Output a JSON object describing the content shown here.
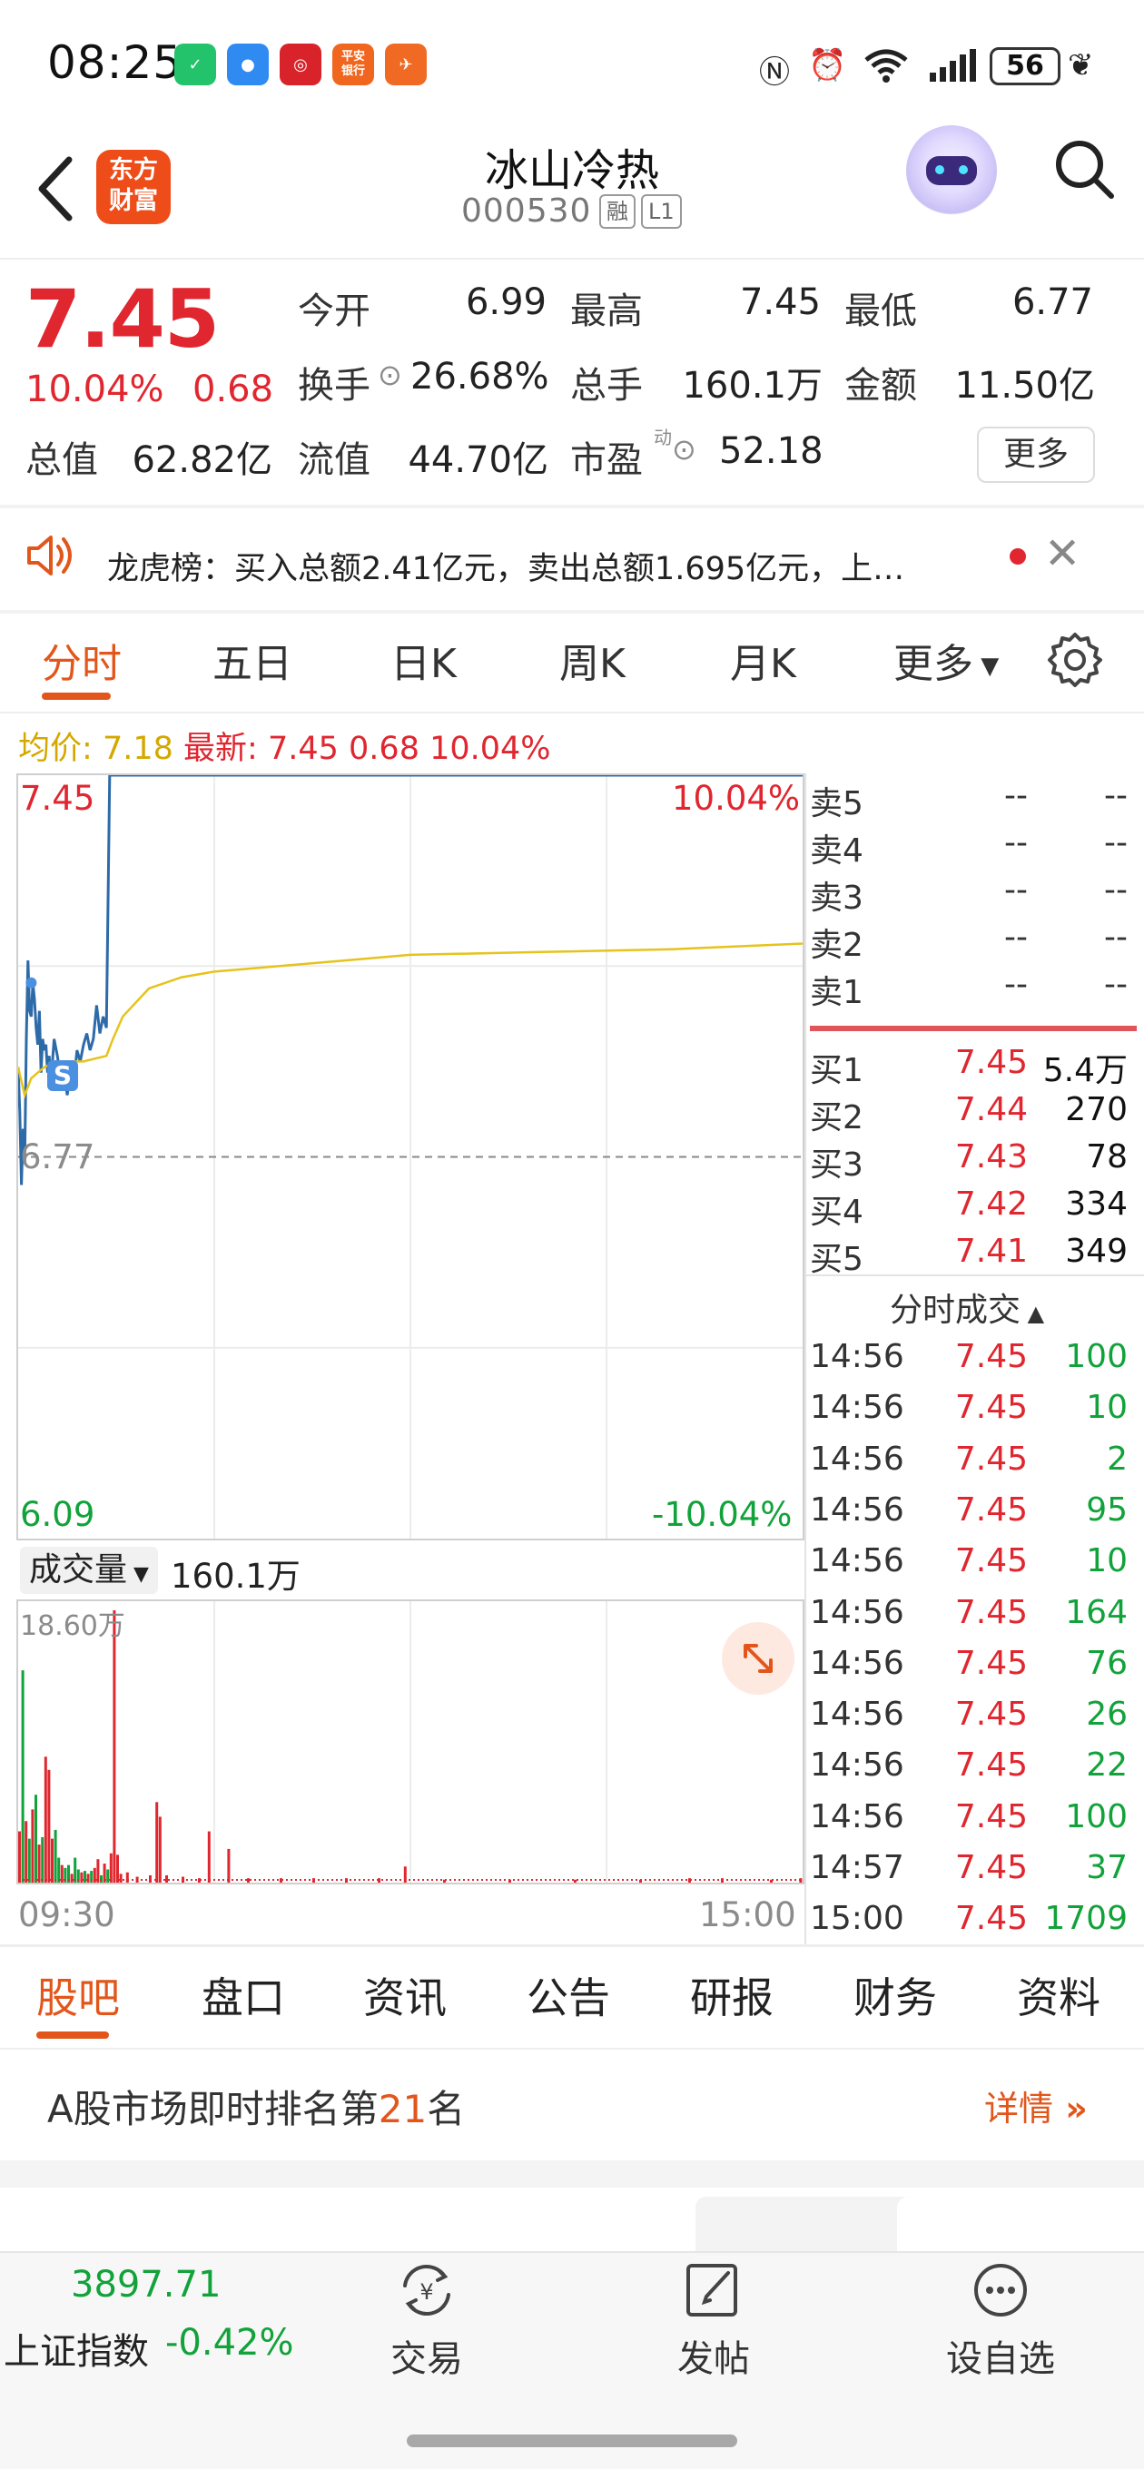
{
  "status_bar": {
    "time": "08:25",
    "battery": "56",
    "app_icons": [
      "wechat-pay-icon",
      "message-icon",
      "boc-icon",
      "pingan-icon",
      "forum-icon"
    ],
    "app_icon_text": [
      "",
      "",
      "",
      "平安\n银行",
      ""
    ],
    "system_icons": [
      "nfc-icon",
      "alarm-icon",
      "wifi-icon",
      "signal-icon",
      "battery-icon",
      "leaf-icon"
    ]
  },
  "header": {
    "logo_text": "东方\n财富",
    "stock_name": "冰山冷热",
    "stock_code": "000530",
    "tag_margin": "融",
    "tag_level": "L1"
  },
  "quote": {
    "price": "7.45",
    "pct": "10.04%",
    "change": "0.68",
    "rows": [
      [
        {
          "label": "今开",
          "value": "6.99",
          "color": "red"
        },
        {
          "label": "最高",
          "value": "7.45",
          "color": "red"
        },
        {
          "label": "最低",
          "value": "6.77",
          "color": "dark"
        }
      ],
      [
        {
          "label": "换手",
          "value": "26.68%",
          "color": "dark"
        },
        {
          "label": "总手",
          "value": "160.1万",
          "color": "dark"
        },
        {
          "label": "金额",
          "value": "11.50亿",
          "color": "dark"
        }
      ],
      [
        {
          "label": "总值",
          "value": "62.82亿",
          "color": "dark"
        },
        {
          "label": "流值",
          "value": "44.70亿",
          "color": "dark"
        },
        {
          "label": "市盈",
          "value": "52.18",
          "color": "dark"
        }
      ]
    ],
    "pe_superscript": "动",
    "more_button": "更多"
  },
  "notice": {
    "text": "龙虎榜：买入总额2.41亿元，卖出总额1.695亿元，上…"
  },
  "chart_tabs": {
    "items": [
      "分时",
      "五日",
      "日K",
      "周K",
      "月K",
      "更多"
    ],
    "active": 0
  },
  "chart_info": {
    "avg_label": "均价:",
    "avg_value": "7.18",
    "latest_label": "最新:",
    "latest_price": "7.45",
    "latest_change": "0.68",
    "latest_pct": "10.04%"
  },
  "chart_data": {
    "type": "line",
    "x_start": "09:30",
    "x_end": "15:00",
    "y_top_label": "7.45",
    "y_bottom_label": "6.09",
    "y_right_top": "10.04%",
    "y_right_bottom": "-10.04%",
    "ref_line_label": "6.77",
    "ylim": [
      6.09,
      7.45
    ],
    "ref_value": 6.77,
    "marker": "S",
    "series": [
      {
        "name": "",
        "color": "#2d6aa8",
        "values_t": [
          0,
          0.5,
          1,
          1.5,
          2,
          2.5,
          3,
          3.5,
          4,
          4.5,
          5,
          5.5,
          6,
          6.5,
          7,
          7.5,
          8,
          8.5,
          9,
          9.5,
          10,
          11,
          12,
          13,
          14,
          15,
          16,
          17,
          18,
          19,
          20,
          21,
          22,
          23,
          24,
          25,
          26,
          27,
          28,
          28.5,
          29,
          60,
          120,
          240
        ],
        "values": [
          6.93,
          6.85,
          6.72,
          6.82,
          6.76,
          6.98,
          7.12,
          7.03,
          7.02,
          7.08,
          7.05,
          7.0,
          6.97,
          7.03,
          6.92,
          6.98,
          6.96,
          6.97,
          6.92,
          6.95,
          6.9,
          6.98,
          6.95,
          6.91,
          6.93,
          6.88,
          6.92,
          6.9,
          6.96,
          6.94,
          6.97,
          6.99,
          6.96,
          6.98,
          7.04,
          6.99,
          7.02,
          7.0,
          7.45,
          7.45,
          7.45,
          7.45,
          7.45,
          7.45
        ]
      },
      {
        "name": "",
        "color": "#e6c31c",
        "values_t": [
          0,
          2,
          4,
          8,
          12,
          20,
          27,
          29,
          32,
          40,
          50,
          60,
          80,
          100,
          120,
          160,
          200,
          240
        ],
        "values": [
          6.93,
          6.88,
          6.91,
          6.93,
          6.94,
          6.94,
          6.95,
          6.98,
          7.02,
          7.07,
          7.09,
          7.1,
          7.11,
          7.12,
          7.13,
          7.135,
          7.14,
          7.15
        ]
      }
    ]
  },
  "volume": {
    "selector": "成交量",
    "total": "160.1万",
    "max_label": "18.60万",
    "max_value": 18.6,
    "bars": [
      {
        "t": 0,
        "v": 3.5,
        "c": "r"
      },
      {
        "t": 1,
        "v": 14.5,
        "c": "g"
      },
      {
        "t": 2,
        "v": 4.2,
        "c": "r"
      },
      {
        "t": 3,
        "v": 3.0,
        "c": "g"
      },
      {
        "t": 4,
        "v": 5.0,
        "c": "r"
      },
      {
        "t": 5,
        "v": 6.0,
        "c": "g"
      },
      {
        "t": 6,
        "v": 2.6,
        "c": "r"
      },
      {
        "t": 7,
        "v": 3.1,
        "c": "g"
      },
      {
        "t": 8,
        "v": 8.6,
        "c": "r"
      },
      {
        "t": 9,
        "v": 7.7,
        "c": "r"
      },
      {
        "t": 10,
        "v": 3.0,
        "c": "r"
      },
      {
        "t": 11,
        "v": 3.6,
        "c": "g"
      },
      {
        "t": 12,
        "v": 1.7,
        "c": "g"
      },
      {
        "t": 13,
        "v": 1.2,
        "c": "r"
      },
      {
        "t": 14,
        "v": 1.0,
        "c": "g"
      },
      {
        "t": 15,
        "v": 1.2,
        "c": "g"
      },
      {
        "t": 16,
        "v": 0.6,
        "c": "r"
      },
      {
        "t": 17,
        "v": 1.7,
        "c": "g"
      },
      {
        "t": 18,
        "v": 0.9,
        "c": "g"
      },
      {
        "t": 19,
        "v": 0.7,
        "c": "r"
      },
      {
        "t": 20,
        "v": 0.8,
        "c": "g"
      },
      {
        "t": 21,
        "v": 0.6,
        "c": "r"
      },
      {
        "t": 22,
        "v": 0.8,
        "c": "g"
      },
      {
        "t": 23,
        "v": 1.0,
        "c": "r"
      },
      {
        "t": 24,
        "v": 1.6,
        "c": "r"
      },
      {
        "t": 25,
        "v": 0.5,
        "c": "g"
      },
      {
        "t": 26,
        "v": 1.3,
        "c": "r"
      },
      {
        "t": 27,
        "v": 0.9,
        "c": "g"
      },
      {
        "t": 28,
        "v": 2.0,
        "c": "r"
      },
      {
        "t": 29,
        "v": 18.6,
        "c": "r"
      },
      {
        "t": 30,
        "v": 1.9,
        "c": "r"
      },
      {
        "t": 31,
        "v": 0.6,
        "c": "r"
      },
      {
        "t": 33,
        "v": 0.7,
        "c": "r"
      },
      {
        "t": 36,
        "v": 0.4,
        "c": "r"
      },
      {
        "t": 40,
        "v": 0.5,
        "c": "r"
      },
      {
        "t": 42,
        "v": 5.5,
        "c": "r"
      },
      {
        "t": 43,
        "v": 4.5,
        "c": "r"
      },
      {
        "t": 45,
        "v": 0.5,
        "c": "r"
      },
      {
        "t": 50,
        "v": 0.4,
        "c": "r"
      },
      {
        "t": 55,
        "v": 0.3,
        "c": "r"
      },
      {
        "t": 58,
        "v": 3.5,
        "c": "r"
      },
      {
        "t": 64,
        "v": 2.3,
        "c": "r"
      },
      {
        "t": 70,
        "v": 0.3,
        "c": "r"
      },
      {
        "t": 80,
        "v": 0.3,
        "c": "r"
      },
      {
        "t": 90,
        "v": 0.3,
        "c": "r"
      },
      {
        "t": 100,
        "v": 0.3,
        "c": "r"
      },
      {
        "t": 110,
        "v": 0.3,
        "c": "r"
      },
      {
        "t": 118,
        "v": 1.1,
        "c": "r"
      },
      {
        "t": 130,
        "v": 0.2,
        "c": "r"
      },
      {
        "t": 150,
        "v": 0.2,
        "c": "r"
      },
      {
        "t": 170,
        "v": 0.2,
        "c": "r"
      },
      {
        "t": 190,
        "v": 0.2,
        "c": "r"
      },
      {
        "t": 205,
        "v": 0.3,
        "c": "r"
      },
      {
        "t": 215,
        "v": 0.3,
        "c": "r"
      },
      {
        "t": 230,
        "v": 0.2,
        "c": "r"
      },
      {
        "t": 239,
        "v": 0.3,
        "c": "r"
      }
    ],
    "colors": {
      "r": "#e0262f",
      "g": "#11a23a"
    }
  },
  "order_book": {
    "asks": [
      {
        "label": "卖5",
        "price": "--",
        "vol": "--"
      },
      {
        "label": "卖4",
        "price": "--",
        "vol": "--"
      },
      {
        "label": "卖3",
        "price": "--",
        "vol": "--"
      },
      {
        "label": "卖2",
        "price": "--",
        "vol": "--"
      },
      {
        "label": "卖1",
        "price": "--",
        "vol": "--"
      }
    ],
    "bids": [
      {
        "label": "买1",
        "price": "7.45",
        "vol": "5.4万"
      },
      {
        "label": "买2",
        "price": "7.44",
        "vol": "270"
      },
      {
        "label": "买3",
        "price": "7.43",
        "vol": "78"
      },
      {
        "label": "买4",
        "price": "7.42",
        "vol": "334"
      },
      {
        "label": "买5",
        "price": "7.41",
        "vol": "349"
      }
    ],
    "ticks_title": "分时成交",
    "ticks": [
      {
        "time": "14:56",
        "price": "7.45",
        "vol": "100"
      },
      {
        "time": "14:56",
        "price": "7.45",
        "vol": "10"
      },
      {
        "time": "14:56",
        "price": "7.45",
        "vol": "2"
      },
      {
        "time": "14:56",
        "price": "7.45",
        "vol": "95"
      },
      {
        "time": "14:56",
        "price": "7.45",
        "vol": "10"
      },
      {
        "time": "14:56",
        "price": "7.45",
        "vol": "164"
      },
      {
        "time": "14:56",
        "price": "7.45",
        "vol": "76"
      },
      {
        "time": "14:56",
        "price": "7.45",
        "vol": "26"
      },
      {
        "time": "14:56",
        "price": "7.45",
        "vol": "22"
      },
      {
        "time": "14:56",
        "price": "7.45",
        "vol": "100"
      },
      {
        "time": "14:57",
        "price": "7.45",
        "vol": "37"
      },
      {
        "time": "15:00",
        "price": "7.45",
        "vol": "1709"
      }
    ]
  },
  "content_tabs": {
    "items": [
      "股吧",
      "盘口",
      "资讯",
      "公告",
      "研报",
      "财务",
      "资料"
    ],
    "active": 0
  },
  "rank": {
    "prefix": "A股市场即时排名第",
    "number": "21",
    "suffix": "名",
    "detail": "详情"
  },
  "dock": {
    "index_value": "3897.71",
    "index_name": "上证指数",
    "index_pct": "-0.42%",
    "items": [
      {
        "label": "交易",
        "icon": "yen-cycle-icon"
      },
      {
        "label": "发帖",
        "icon": "compose-icon"
      },
      {
        "label": "设自选",
        "icon": "more-icon"
      }
    ]
  },
  "colors": {
    "up": "#e0262f",
    "down": "#11a23a",
    "accent": "#e2561b",
    "price_line": "#2d6aa8",
    "avg_line": "#e6c31c"
  }
}
